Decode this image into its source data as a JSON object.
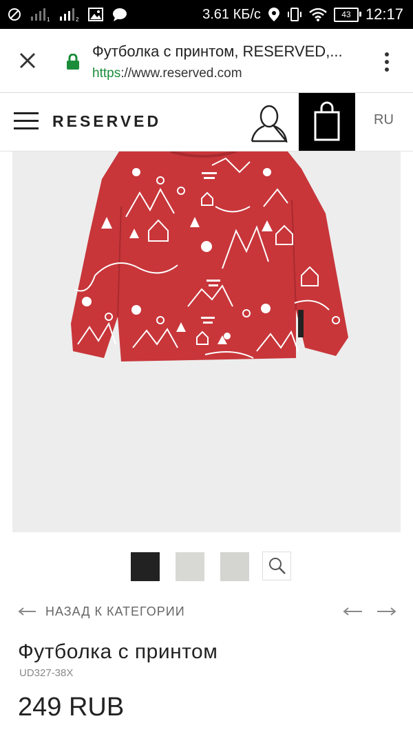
{
  "status_bar": {
    "speed": "3.61 КБ/с",
    "battery": "43",
    "time": "12:17",
    "icons": [
      "no-sim-icon",
      "signal-1-icon",
      "signal-2-icon",
      "image-icon",
      "chat-icon",
      "location-icon",
      "vibrate-icon",
      "wifi-icon",
      "battery-icon"
    ]
  },
  "browser": {
    "page_title": "Футболка с принтом, RESERVED,...",
    "url_scheme": "https",
    "url_rest": "://www.reserved.com",
    "accent_color": "#1a8c3a"
  },
  "header": {
    "brand": "RESERVED",
    "language": "RU"
  },
  "product": {
    "image_alt": "red long-sleeve shirt with white print",
    "back_label": "НАЗАД К КАТЕГОРИИ",
    "title": "Футболка с принтом",
    "sku": "UD327-38X",
    "price": "249 RUB",
    "thumbnail_colors": [
      "#222222",
      "#d8d8d4",
      "#d4d4d0"
    ],
    "shirt_color": "#c8363a"
  }
}
